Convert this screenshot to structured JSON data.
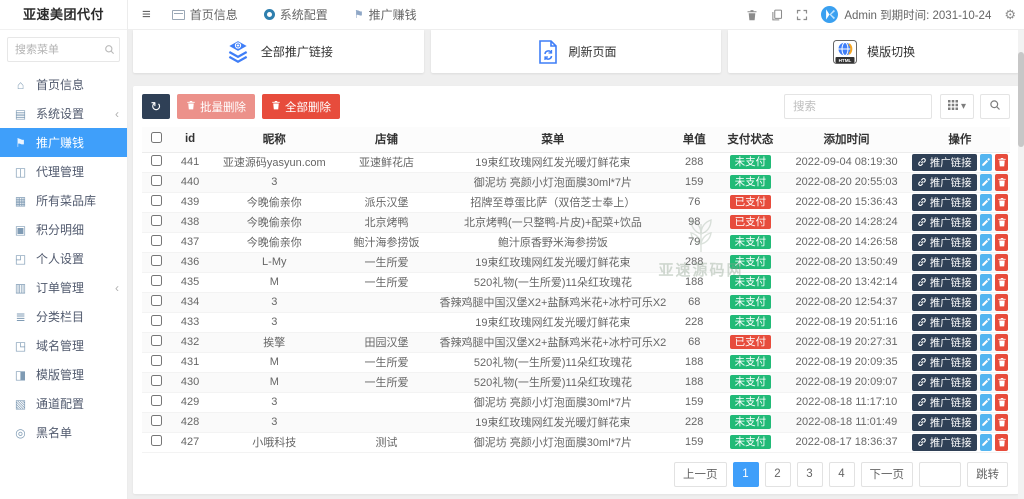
{
  "app": {
    "title": "亚速美团代付"
  },
  "sidebar": {
    "search_placeholder": "搜索菜单",
    "items": [
      {
        "label": "首页信息",
        "icon": "home-icon",
        "active": false,
        "chevron": false
      },
      {
        "label": "系统设置",
        "icon": "settings-icon",
        "active": false,
        "chevron": true
      },
      {
        "label": "推广赚钱",
        "icon": "promote-icon",
        "active": true,
        "chevron": false
      },
      {
        "label": "代理管理",
        "icon": "agent-icon",
        "active": false,
        "chevron": false
      },
      {
        "label": "所有菜品库",
        "icon": "dishes-icon",
        "active": false,
        "chevron": false
      },
      {
        "label": "积分明细",
        "icon": "points-icon",
        "active": false,
        "chevron": false
      },
      {
        "label": "个人设置",
        "icon": "profile-icon",
        "active": false,
        "chevron": false
      },
      {
        "label": "订单管理",
        "icon": "orders-icon",
        "active": false,
        "chevron": true
      },
      {
        "label": "分类栏目",
        "icon": "category-icon",
        "active": false,
        "chevron": false
      },
      {
        "label": "域名管理",
        "icon": "domain-icon",
        "active": false,
        "chevron": false
      },
      {
        "label": "模版管理",
        "icon": "template-icon",
        "active": false,
        "chevron": false
      },
      {
        "label": "通道配置",
        "icon": "channel-icon",
        "active": false,
        "chevron": false
      },
      {
        "label": "黑名单",
        "icon": "blacklist-icon",
        "active": false,
        "chevron": false
      }
    ]
  },
  "topbar": {
    "tabs": [
      {
        "label": "首页信息",
        "icon": "window-icon"
      },
      {
        "label": "系统配置",
        "icon": "ring-icon"
      },
      {
        "label": "推广赚钱",
        "icon": "flag-icon"
      }
    ],
    "account_text": "Admin 到期时间: 2031-10-24"
  },
  "cards": [
    {
      "label": "全部推广链接",
      "icon": "layers-icon"
    },
    {
      "label": "刷新页面",
      "icon": "refresh-page-icon"
    },
    {
      "label": "模版切换",
      "icon": "html-template-icon"
    }
  ],
  "toolbar": {
    "batch_delete_label": "批量删除",
    "delete_all_label": "全部删除",
    "search_placeholder": "搜索"
  },
  "table": {
    "headers": [
      "id",
      "昵称",
      "店铺",
      "菜单",
      "单值",
      "支付状态",
      "添加时间",
      "操作"
    ],
    "link_button_label": "推广链接",
    "rows": [
      {
        "id": "441",
        "nickname": "亚速源码yasyun.com",
        "shop": "亚速鲜花店",
        "menu": "19束红玫瑰网红发光暖灯鲜花束",
        "value": "288",
        "status": "未支付",
        "paid": false,
        "time": "2022-09-04 08:19:30"
      },
      {
        "id": "440",
        "nickname": "3",
        "shop": "",
        "menu": "御泥坊 亮颜小灯泡面膜30ml*7片",
        "value": "159",
        "status": "未支付",
        "paid": false,
        "time": "2022-08-20 20:55:03"
      },
      {
        "id": "439",
        "nickname": "今晚偷亲你",
        "shop": "派乐汉堡",
        "menu": "招牌至尊蛋比萨（双倍芝士奉上）",
        "value": "76",
        "status": "已支付",
        "paid": true,
        "time": "2022-08-20 15:36:43"
      },
      {
        "id": "438",
        "nickname": "今晚偷亲你",
        "shop": "北京烤鸭",
        "menu": "北京烤鸭(一只整鸭-片皮)+配菜+饮品",
        "value": "98",
        "status": "已支付",
        "paid": true,
        "time": "2022-08-20 14:28:24"
      },
      {
        "id": "437",
        "nickname": "今晚偷亲你",
        "shop": "鲍汁海参捞饭",
        "menu": "鲍汁原香野米海参捞饭",
        "value": "79",
        "status": "未支付",
        "paid": false,
        "time": "2022-08-20 14:26:58"
      },
      {
        "id": "436",
        "nickname": "L-My",
        "shop": "一生所爱",
        "menu": "19束红玫瑰网红发光暖灯鲜花束",
        "value": "288",
        "status": "未支付",
        "paid": false,
        "time": "2022-08-20 13:50:49"
      },
      {
        "id": "435",
        "nickname": "M",
        "shop": "一生所爱",
        "menu": "520礼物(一生所爱)11朵红玫瑰花",
        "value": "188",
        "status": "未支付",
        "paid": false,
        "time": "2022-08-20 13:42:14"
      },
      {
        "id": "434",
        "nickname": "3",
        "shop": "",
        "menu": "香辣鸡腿中国汉堡X2+盐酥鸡米花+冰柠可乐X2",
        "value": "68",
        "status": "未支付",
        "paid": false,
        "time": "2022-08-20 12:54:37"
      },
      {
        "id": "433",
        "nickname": "3",
        "shop": "",
        "menu": "19束红玫瑰网红发光暖灯鲜花束",
        "value": "228",
        "status": "未支付",
        "paid": false,
        "time": "2022-08-19 20:51:16"
      },
      {
        "id": "432",
        "nickname": "挨擎",
        "shop": "田园汉堡",
        "menu": "香辣鸡腿中国汉堡X2+盐酥鸡米花+冰柠可乐X2",
        "value": "68",
        "status": "已支付",
        "paid": true,
        "time": "2022-08-19 20:27:31"
      },
      {
        "id": "431",
        "nickname": "M",
        "shop": "一生所爱",
        "menu": "520礼物(一生所爱)11朵红玫瑰花",
        "value": "188",
        "status": "未支付",
        "paid": false,
        "time": "2022-08-19 20:09:35"
      },
      {
        "id": "430",
        "nickname": "M",
        "shop": "一生所爱",
        "menu": "520礼物(一生所爱)11朵红玫瑰花",
        "value": "188",
        "status": "未支付",
        "paid": false,
        "time": "2022-08-19 20:09:07"
      },
      {
        "id": "429",
        "nickname": "3",
        "shop": "",
        "menu": "御泥坊 亮颜小灯泡面膜30ml*7片",
        "value": "159",
        "status": "未支付",
        "paid": false,
        "time": "2022-08-18 11:17:10"
      },
      {
        "id": "428",
        "nickname": "3",
        "shop": "",
        "menu": "19束红玫瑰网红发光暖灯鲜花束",
        "value": "228",
        "status": "未支付",
        "paid": false,
        "time": "2022-08-18 11:01:49"
      },
      {
        "id": "427",
        "nickname": "小哦科技",
        "shop": "测试",
        "menu": "御泥坊 亮颜小灯泡面膜30ml*7片",
        "value": "159",
        "status": "未支付",
        "paid": false,
        "time": "2022-08-17 18:36:37"
      }
    ]
  },
  "pagination": {
    "prev_label": "上一页",
    "pages": [
      "1",
      "2",
      "3",
      "4"
    ],
    "active_page": "1",
    "next_label": "下一页",
    "jump_label": "跳转"
  },
  "watermark": {
    "text": "亚速源码网"
  },
  "colors": {
    "accent": "#3f9ffa",
    "unpaid_green": "#21ba77",
    "paid_red": "#e74c3c",
    "navy": "#2f4056",
    "batch_delete_muted_red": "#ec918a",
    "edit_blue": "#54b5f0"
  }
}
